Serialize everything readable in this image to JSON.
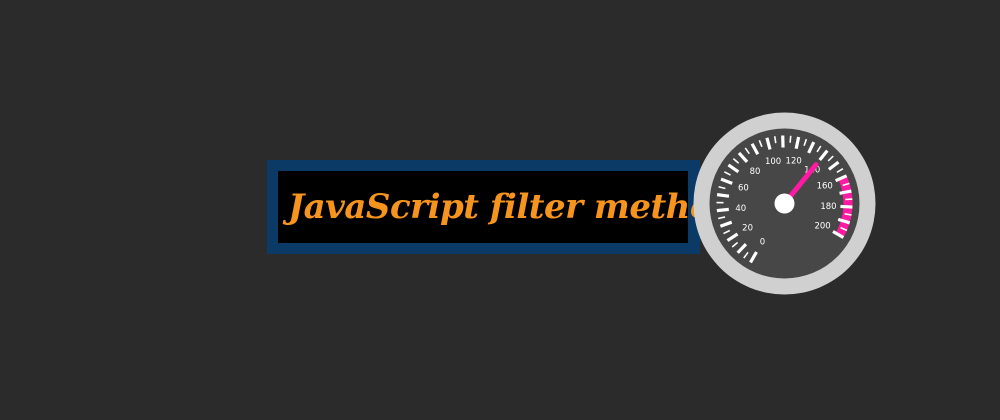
{
  "banner": {
    "title": "JavaScript filter method",
    "title_color": "#f7941d",
    "border_color": "#0b3a66",
    "fill_color": "#000000"
  },
  "speedometer": {
    "icon": "speedometer-icon",
    "scale_labels": [
      "0",
      "20",
      "40",
      "60",
      "80",
      "100",
      "120",
      "140",
      "160",
      "180",
      "200"
    ],
    "scale_min": 0,
    "scale_max": 200,
    "needle_value": 140,
    "redline_from": 160,
    "redline_to": 200,
    "needle_color": "#ff1aa3",
    "redline_color": "#ff1aa3",
    "bezel_color": "#d0d0d0",
    "face_color": "#474747"
  }
}
